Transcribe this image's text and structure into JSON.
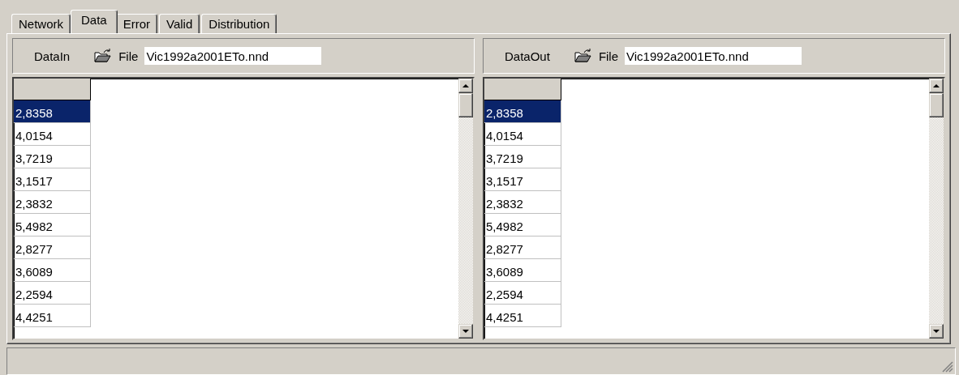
{
  "tabs": [
    {
      "label": "Network",
      "selected": false
    },
    {
      "label": "Data",
      "selected": true
    },
    {
      "label": "Error",
      "selected": false
    },
    {
      "label": "Valid",
      "selected": false
    },
    {
      "label": "Distribution",
      "selected": false
    }
  ],
  "panes": [
    {
      "title": "DataIn",
      "file_label": "File",
      "file_value": "Vic1992a2001ETo.nnd",
      "rows": [
        {
          "value": "2,8358",
          "selected": true
        },
        {
          "value": "4,0154",
          "selected": false
        },
        {
          "value": "3,7219",
          "selected": false
        },
        {
          "value": "3,1517",
          "selected": false
        },
        {
          "value": "2,3832",
          "selected": false
        },
        {
          "value": "5,4982",
          "selected": false
        },
        {
          "value": "2,8277",
          "selected": false
        },
        {
          "value": "3,6089",
          "selected": false
        },
        {
          "value": "2,2594",
          "selected": false
        },
        {
          "value": "4,4251",
          "selected": false
        }
      ]
    },
    {
      "title": "DataOut",
      "file_label": "File",
      "file_value": "Vic1992a2001ETo.nnd",
      "rows": [
        {
          "value": "2,8358",
          "selected": true
        },
        {
          "value": "4,0154",
          "selected": false
        },
        {
          "value": "3,7219",
          "selected": false
        },
        {
          "value": "3,1517",
          "selected": false
        },
        {
          "value": "2,3832",
          "selected": false
        },
        {
          "value": "5,4982",
          "selected": false
        },
        {
          "value": "2,8277",
          "selected": false
        },
        {
          "value": "3,6089",
          "selected": false
        },
        {
          "value": "2,2594",
          "selected": false
        },
        {
          "value": "4,4251",
          "selected": false
        }
      ]
    }
  ]
}
